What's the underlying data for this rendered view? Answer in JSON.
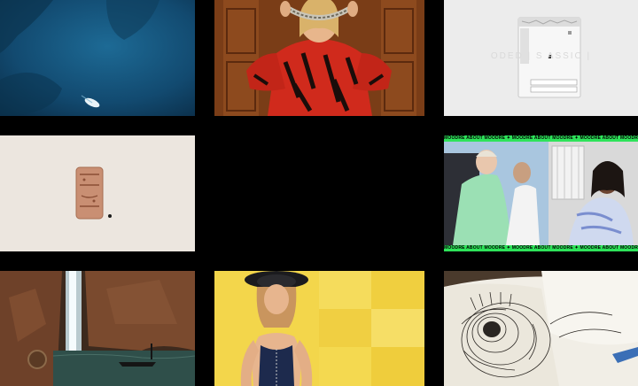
{
  "gallery": {
    "tiles": [
      {
        "id": "tile-aerial-sea"
      },
      {
        "id": "tile-fashion-red"
      },
      {
        "id": "tile-product-pouch",
        "overlay_text": "ODED  |  S        ASSIC  |"
      },
      {
        "id": "tile-wine-cork"
      },
      {
        "id": "tile-empty"
      },
      {
        "id": "tile-moodre-banner",
        "banner_text": "MOODRE ABOUT MOODRE  ✦  MOODRE ABOUT MOODRE  ✦  MOODRE ABOUT MOODRE  ✦  MOODRE ABOUT MOODRE"
      },
      {
        "id": "tile-waterfall"
      },
      {
        "id": "tile-swimwear-yellow"
      },
      {
        "id": "tile-sketchbook"
      }
    ]
  },
  "colors": {
    "background": "#000000",
    "banner_green": "#2ee35a",
    "yellow": "#f3d64b"
  }
}
